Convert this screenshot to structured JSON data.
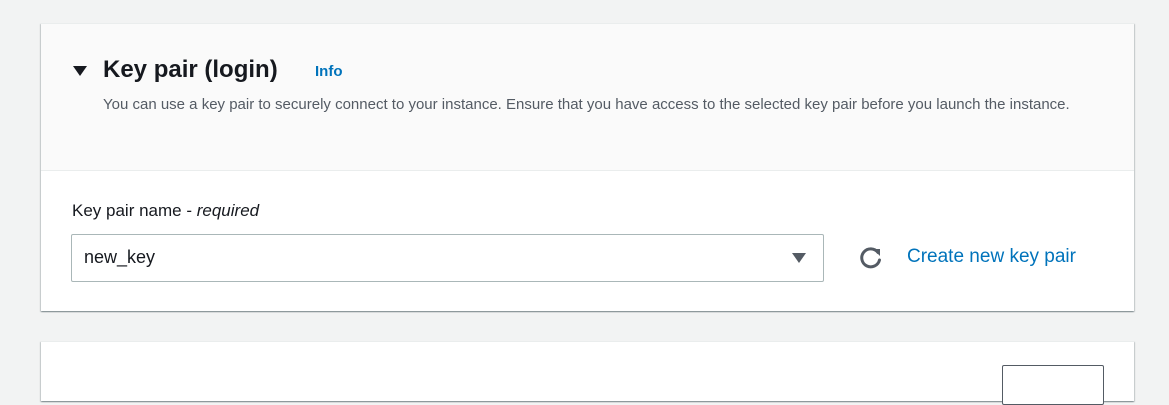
{
  "key_pair_section": {
    "title": "Key pair (login)",
    "info_label": "Info",
    "description": "You can use a key pair to securely connect to your instance. Ensure that you have access to the selected key pair before you launch the instance.",
    "field_label": "Key pair name",
    "field_separator": " - ",
    "field_required": "required",
    "selected_key_pair": "new_key",
    "create_link_label": "Create new key pair",
    "icons": {
      "toggle": "caret-down-icon",
      "select": "dropdown-caret-icon",
      "refresh": "refresh-icon"
    }
  },
  "colors": {
    "link": "#0073bb",
    "text": "#16191f",
    "muted_text": "#545b64",
    "page_background": "#f2f3f3"
  }
}
